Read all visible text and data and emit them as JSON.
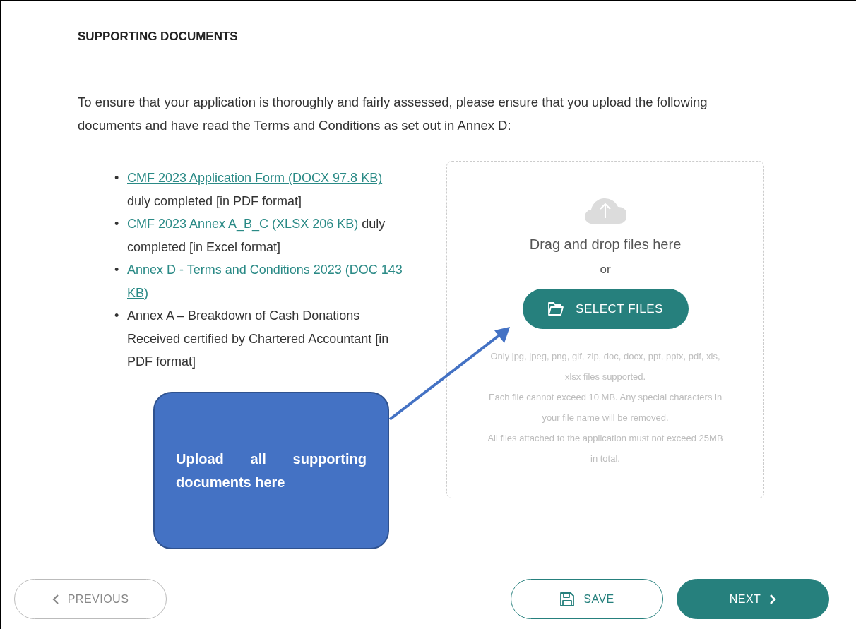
{
  "heading": "SUPPORTING DOCUMENTS",
  "intro": "To ensure that your application is thoroughly and fairly assessed, please ensure that you upload the following documents and have read the Terms and Conditions as set out in Annex D:",
  "documents": [
    {
      "marker": "•",
      "link": "CMF 2023 Application Form (DOCX 97.8 KB)",
      "text": "duly completed [in PDF format]"
    },
    {
      "marker": "•",
      "link": "CMF 2023 Annex A_B_C (XLSX 206 KB)",
      "text": "duly completed [in Excel format]"
    },
    {
      "marker": "•",
      "link": "Annex D - Terms and Conditions 2023 (DOC 143 KB)"
    },
    {
      "marker": "•",
      "text": "Annex A – Breakdown of Cash Donations Received certified by Chartered Accountant [in PDF format]"
    }
  ],
  "dropzone": {
    "prompt": "Drag and drop files here",
    "or": "or",
    "button": "SELECT FILES",
    "notes": [
      "Only jpg, jpeg, png, gif, zip, doc, docx, ppt, pptx, pdf, xls, xlsx files supported.",
      "Each file cannot exceed 10 MB. Any special characters in your file name will be removed.",
      "All files attached to the application must not exceed 25MB in total."
    ]
  },
  "annotation": {
    "text": "Upload all supporting documents here"
  },
  "buttons": [
    {
      "kind": "previous",
      "label": "PREVIOUS"
    },
    {
      "kind": "save",
      "label": "SAVE"
    },
    {
      "kind": "next",
      "label": "NEXT"
    }
  ]
}
